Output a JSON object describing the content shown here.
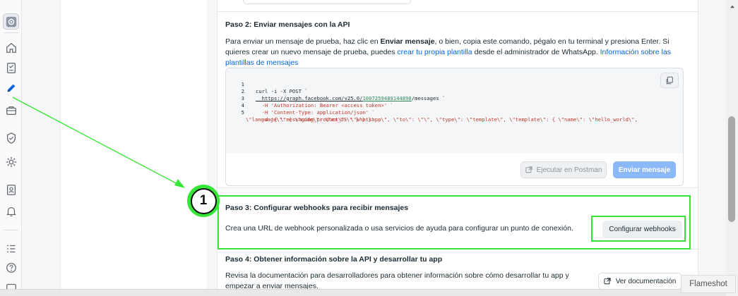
{
  "step2": {
    "title": "Paso 2: Enviar mensajes con la API",
    "para_1": "Para enviar un mensaje de prueba, haz clic en ",
    "para_bold": "Enviar mensaje",
    "para_2": ", o bien, copia este comando, pégalo en tu terminal y presiona Enter. Si quieres crear un nuevo mensaje de prueba, puedes ",
    "link_template": "crear tu propia plantilla",
    "para_3": " desde el administrador de WhatsApp. ",
    "link_info": "Información sobre las plantillas de mensajes",
    "code_lines": [
      {
        "n": "1",
        "text": "curl -i -X POST `"
      },
      {
        "n": "2",
        "pre": "  https://graph.facebook.com/v25.0/",
        "num": "1007259489144890",
        "post": "/messages `"
      },
      {
        "n": "3",
        "text": "  -H 'Authorization: Bearer <access token>' `"
      },
      {
        "n": "4",
        "text": "  -H 'Content-Type: application/json' `"
      },
      {
        "n": "5",
        "text": "  -d '{ \\\"messaging_product\\\": \\\"whatsapp\\\", \\\"to\\\": \\\"\\\", \\\"type\\\": \\\"template\\\", \\\"template\\\": { \\\"name\\\": \\\"hello_world\\\","
      },
      {
        "n": "",
        "text": "\\\"language\\\": { \\\"code\\\": \\\"en_US\\\" } } }'"
      }
    ],
    "btn_postman": "Ejecutar en Postman",
    "btn_send": "Enviar mensaje"
  },
  "step3": {
    "title": "Paso 3: Configurar webhooks para recibir mensajes",
    "para": "Crea una URL de webhook personalizada o usa servicios de ayuda para configurar un punto de conexión.",
    "btn": "Configurar webhooks"
  },
  "step4": {
    "title": "Paso 4: Obtener información sobre la API y desarrollar tu app",
    "para": "Revisa la documentación para desarrolladores para obtener información sobre cómo desarrollar tu app y empezar a enviar mensajes.",
    "btn": "Ver documentación"
  },
  "annotation": {
    "number": "1",
    "color": "#36e636"
  },
  "watermark": "Flameshot",
  "rail_icons": [
    "settings-icon",
    "home-icon",
    "checklist-icon",
    "pencil-icon",
    "briefcase-icon",
    "shield-check-icon",
    "gear-icon",
    "contacts-icon",
    "bell-icon",
    "list-icon",
    "help-icon",
    "window-icon"
  ],
  "colors": {
    "link": "#0064e0",
    "primary_disabled": "#8db8f7",
    "highlight": "#36e636"
  }
}
